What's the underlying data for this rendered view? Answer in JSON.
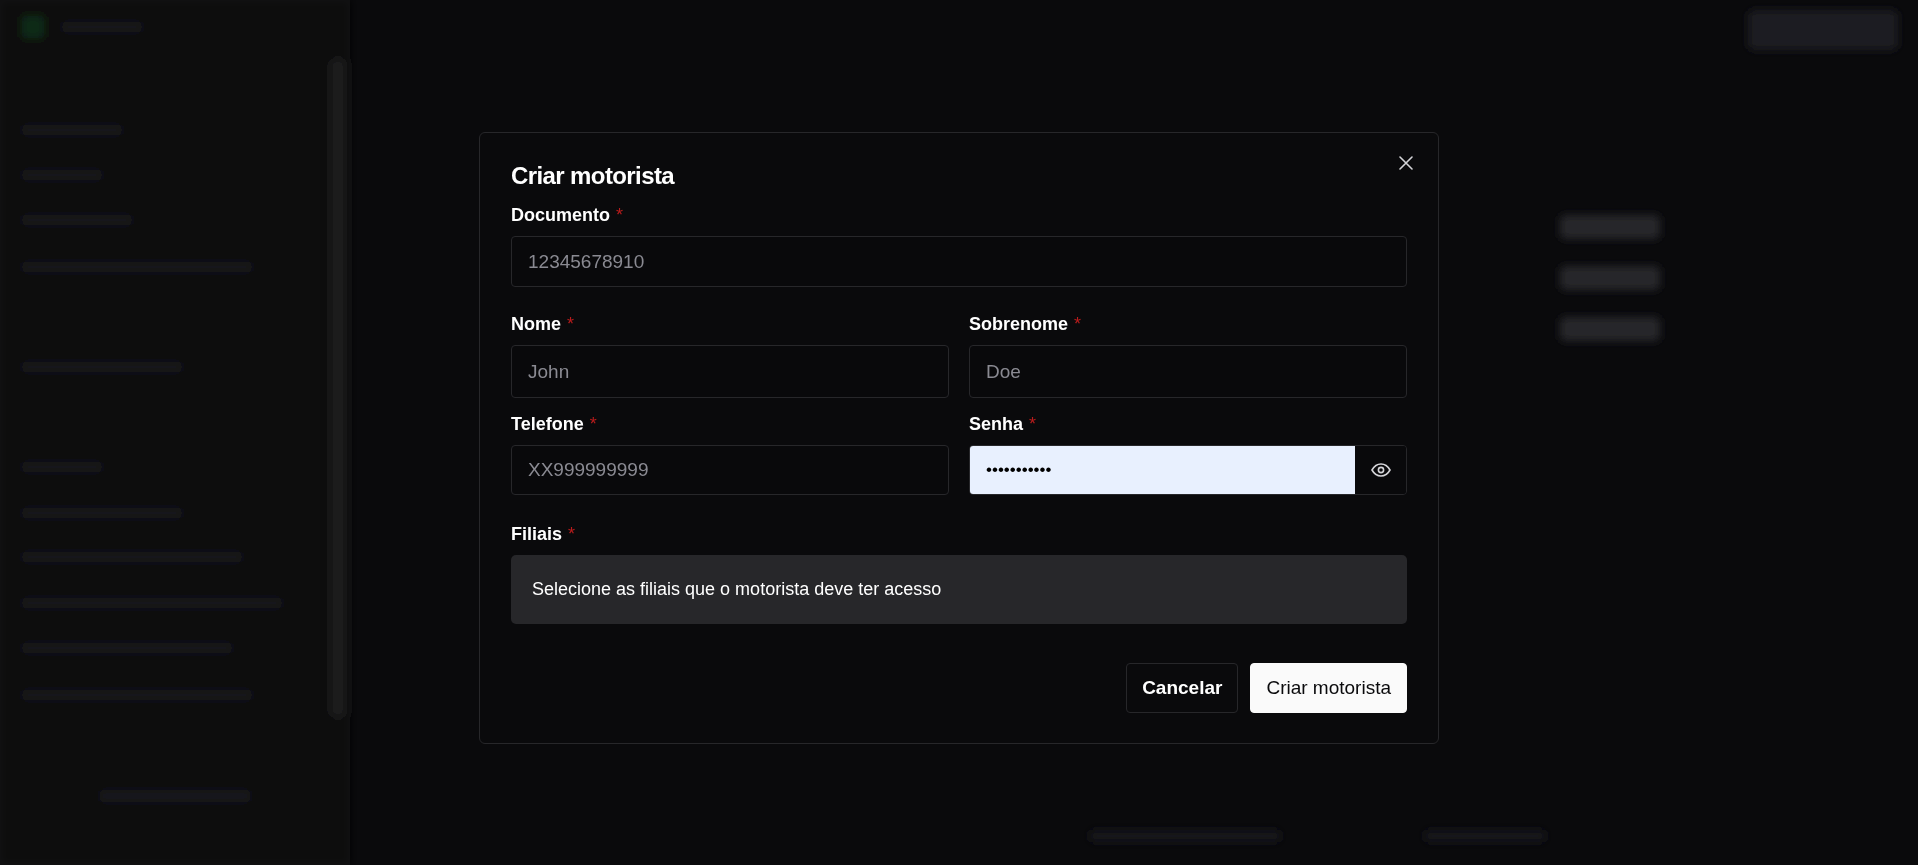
{
  "dialog": {
    "title": "Criar motorista",
    "rows": [
      [
        {
          "kind": "text",
          "label": "Documento",
          "required_mark": "*",
          "placeholder": "12345678910"
        }
      ],
      [
        {
          "kind": "text",
          "label": "Nome",
          "required_mark": "*",
          "placeholder": "John"
        },
        {
          "kind": "text",
          "label": "Sobrenome",
          "required_mark": "*",
          "placeholder": "Doe"
        }
      ],
      [
        {
          "kind": "text",
          "label": "Telefone",
          "required_mark": "*",
          "placeholder": "XX999999999"
        },
        {
          "kind": "password",
          "label": "Senha",
          "required_mark": "*",
          "value": "•••••••••••",
          "autofilled": true
        }
      ]
    ],
    "branches": {
      "label": "Filiais",
      "required_mark": "*",
      "message": "Selecione as filiais que o motorista deve ter acesso"
    },
    "buttons": [
      {
        "label": "Cancelar",
        "kind": "secondary"
      },
      {
        "label": "Criar motorista",
        "kind": "primary"
      }
    ]
  }
}
